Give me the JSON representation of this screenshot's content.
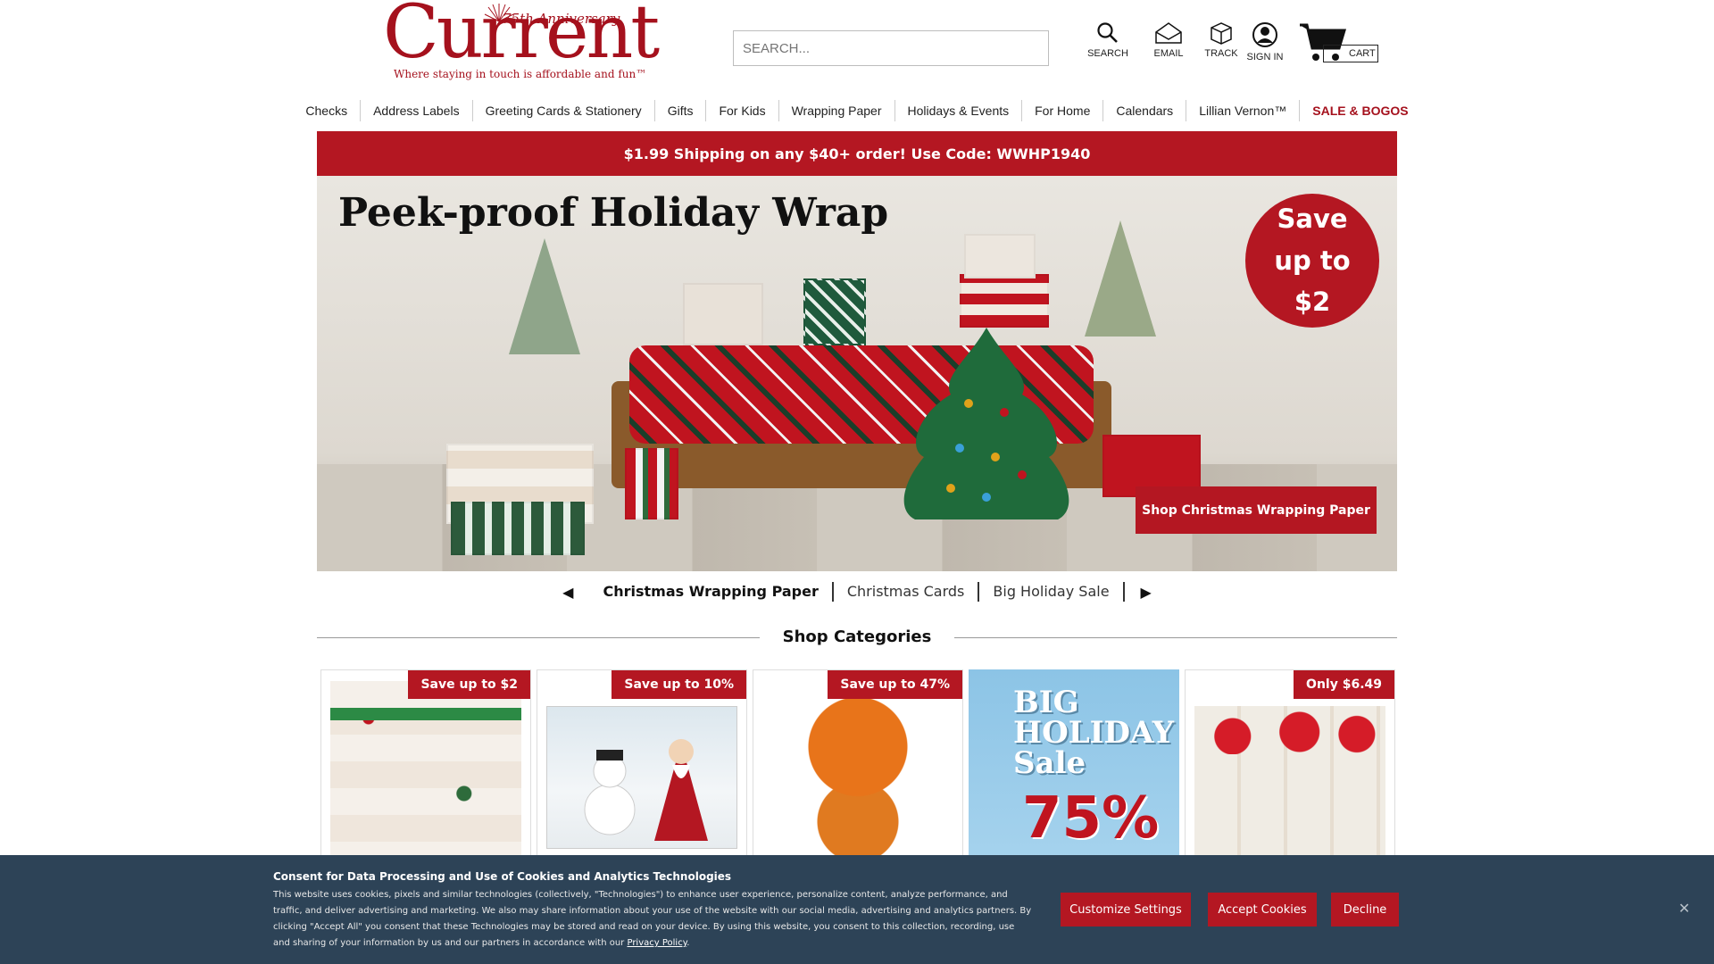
{
  "header": {
    "logo_word": "Current",
    "logo_anniversary": "75th Anniversary",
    "logo_tagline": "Where staying in touch is affordable and fun™",
    "search_placeholder": "SEARCH...",
    "icons": [
      {
        "label": "SEARCH",
        "icon": "search-icon"
      },
      {
        "label": "EMAIL",
        "icon": "envelope-icon"
      },
      {
        "label": "TRACK",
        "icon": "box-icon"
      },
      {
        "label": "SIGN IN",
        "icon": "user-icon"
      }
    ],
    "cart_label": "CART"
  },
  "nav": {
    "items": [
      "Checks",
      "Address Labels",
      "Greeting Cards & Stationery",
      "Gifts",
      "For Kids",
      "Wrapping Paper",
      "Holidays & Events",
      "For Home",
      "Calendars",
      "Lillian Vernon™",
      "SALE & BOGOS"
    ]
  },
  "promo": {
    "text": "$1.99 Shipping on any $40+ order! Use Code: WWHP1940"
  },
  "hero": {
    "title": "Peek-proof Holiday Wrap",
    "badge": "Save up to $2",
    "cta": "Shop Christmas Wrapping Paper"
  },
  "carousel": {
    "items": [
      "Christmas Wrapping Paper",
      "Christmas Cards",
      "Big Holiday Sale"
    ]
  },
  "categories": {
    "title": "Shop Categories",
    "tiles": [
      {
        "badge": "Save up to $2"
      },
      {
        "badge": "Save up to 10%"
      },
      {
        "badge": "Save up to 47%"
      },
      {
        "badge": "",
        "art_title": "BIG HOLIDAY Sale",
        "art_pct": "75%"
      },
      {
        "badge": "Only $6.49"
      }
    ]
  },
  "cookie": {
    "title": "Consent for Data Processing and Use of Cookies and Analytics Technologies",
    "text": "This website uses cookies, pixels and similar technologies (collectively, \"Technologies\") to enhance user experience, personalize content, analyze performance, and traffic, and deliver advertising and marketing. We also may share information about your use of the website with our social media, advertising and analytics partners. By clicking \"Accept All\" you consent that these Technologies may be stored and read on your device. By using this website, you consent to this collection, recording, use and sharing of your information by us and our partners in accordance with our",
    "policy_link": "Privacy Policy",
    "buttons": {
      "customize": "Customize Settings",
      "accept": "Accept Cookies",
      "decline": "Decline"
    },
    "close": "✕"
  },
  "colors": {
    "brand_red": "#b41722",
    "cookie_bg": "#2d4357"
  }
}
